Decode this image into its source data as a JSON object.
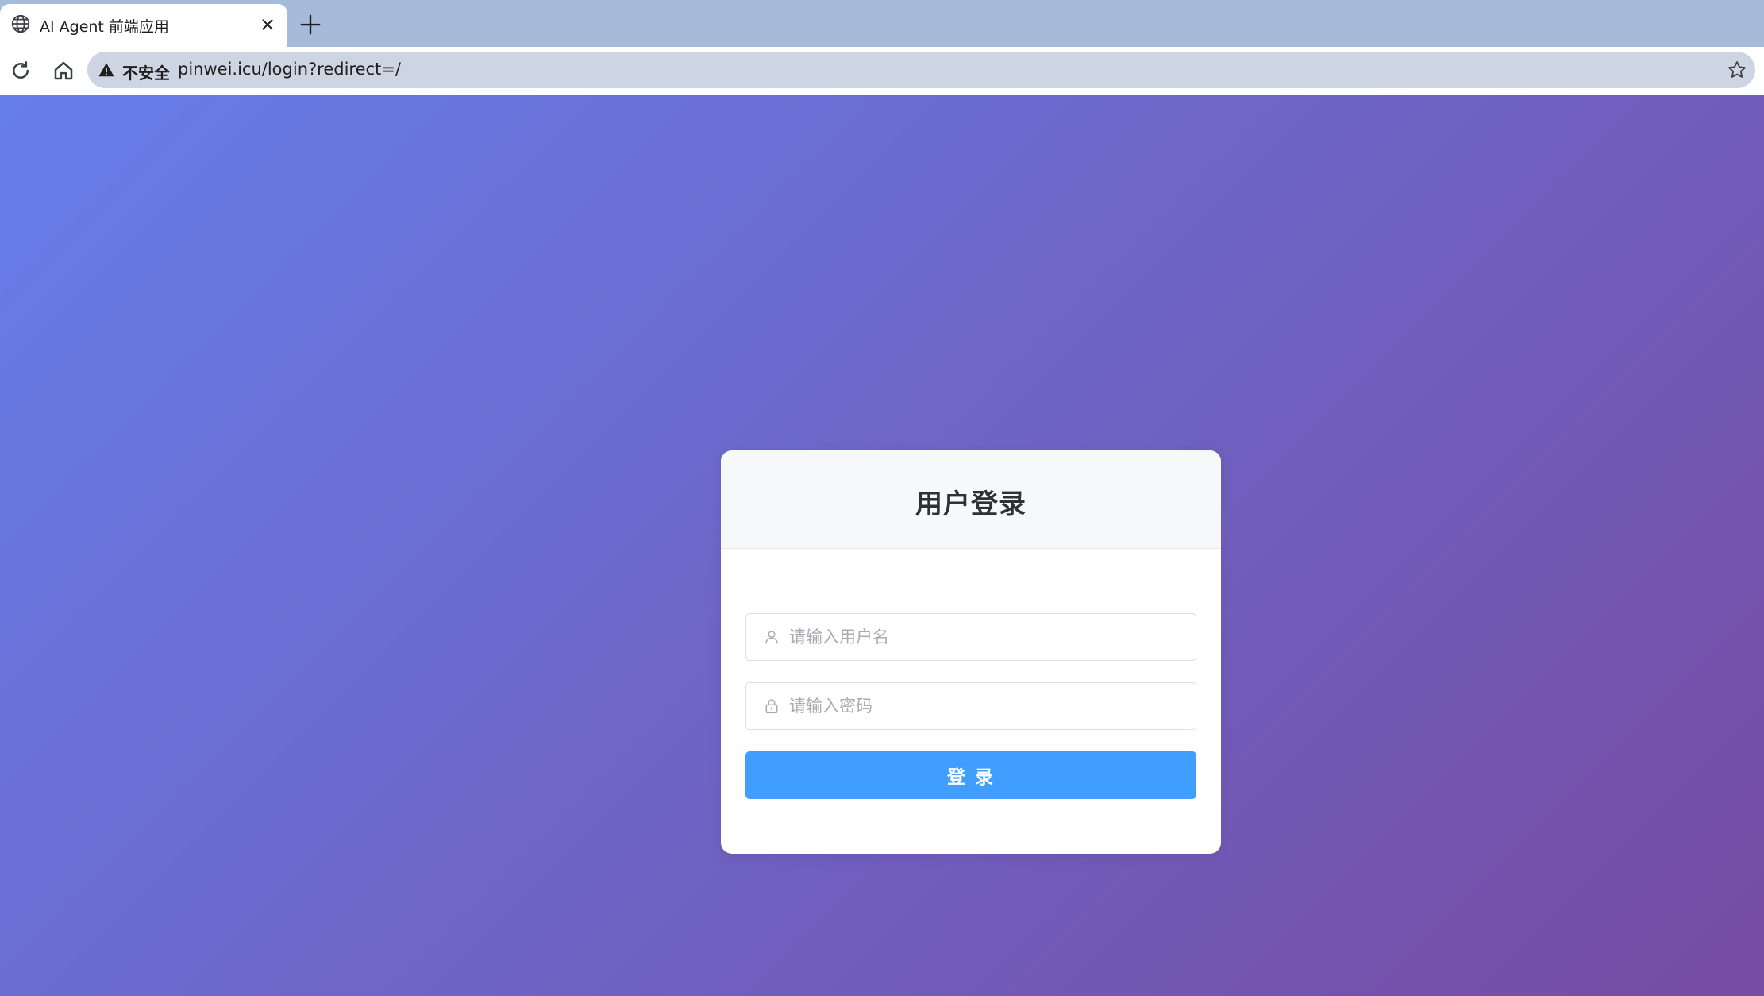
{
  "browser": {
    "tab": {
      "title": "AI Agent 前端应用",
      "icon": "globe-icon"
    },
    "toolbar": {
      "security_label": "不安全",
      "url": "pinwei.icu/login?redirect=/"
    }
  },
  "login": {
    "title": "用户登录",
    "username_placeholder": "请输入用户名",
    "password_placeholder": "请输入密码",
    "submit_label": "登 录"
  },
  "colors": {
    "gradient_start": "#667eea",
    "gradient_end": "#764ba2",
    "primary_button": "#409eff",
    "tabstrip": "#a6bbd9",
    "omnibox": "#cdd5e2"
  }
}
